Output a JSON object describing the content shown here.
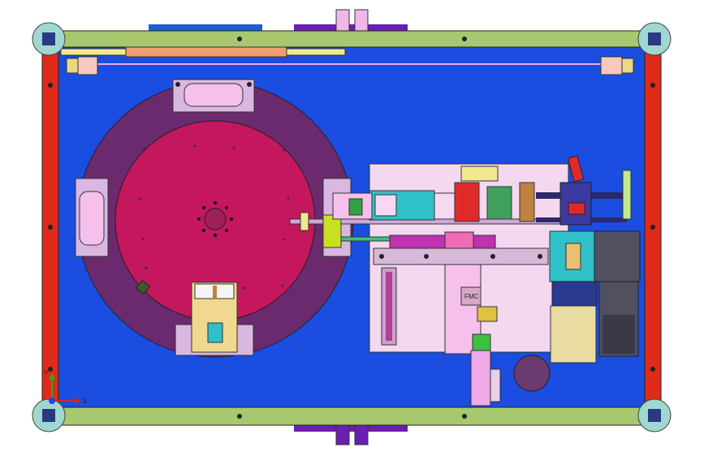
{
  "view": {
    "axis_x_label": "X",
    "axis_y_label": "Y",
    "component_label": "FMC"
  },
  "colors": {
    "background_plate": "#1a4de0",
    "frame_rail": "#a8c870",
    "side_rail": "#e02a1a",
    "turntable_outer": "#6b2a6e",
    "turntable_inner": "#c4175e",
    "corner_foot": "#9fd8d0",
    "mechanism_plate": "#f4d8f0",
    "motor_body": "#e8dca0",
    "bracket": "#f0a8e8",
    "teal_block": "#30c0c8"
  }
}
